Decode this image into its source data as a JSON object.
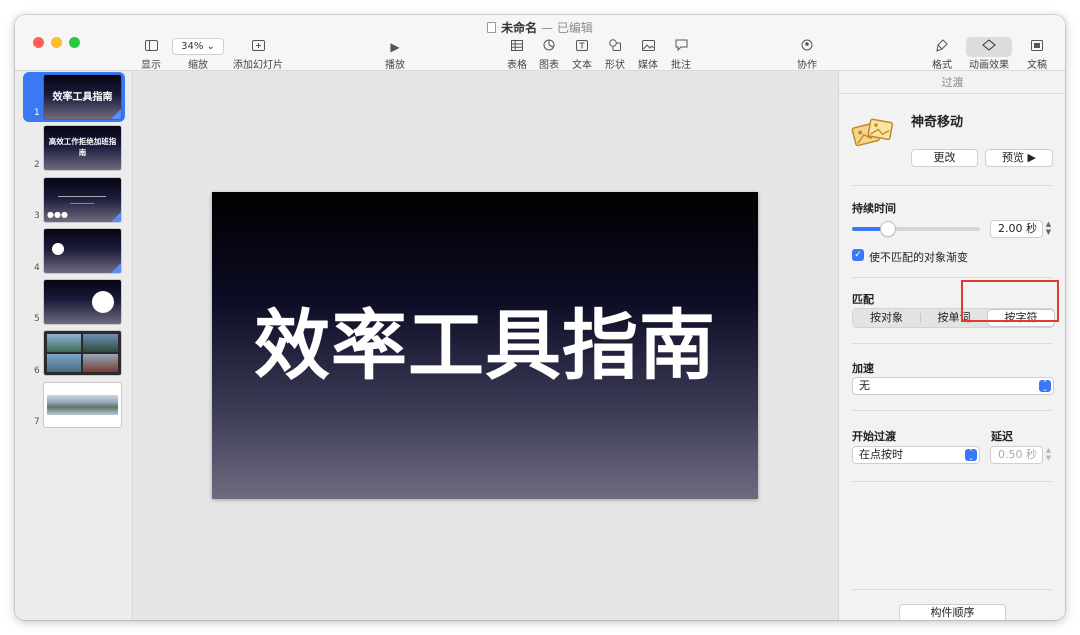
{
  "window": {
    "title": "未命名",
    "separator": "—",
    "status": "已编辑",
    "traffic_colors": [
      "#ff5f57",
      "#febc2e",
      "#28c840"
    ]
  },
  "toolbar": {
    "view_label": "显示",
    "zoom_value": "34%",
    "zoom_label": "缩放",
    "add_slide_label": "添加幻灯片",
    "play_label": "播放",
    "table_label": "表格",
    "chart_label": "图表",
    "text_label": "文本",
    "shape_label": "形状",
    "media_label": "媒体",
    "comment_label": "批注",
    "collaborate_label": "协作",
    "format_label": "格式",
    "animate_label": "动画效果",
    "document_label": "文稿"
  },
  "slides": [
    {
      "num": "1",
      "title": "效率工具指南"
    },
    {
      "num": "2",
      "title": "高效工作拒绝加班指南"
    },
    {
      "num": "3"
    },
    {
      "num": "4"
    },
    {
      "num": "5"
    },
    {
      "num": "6"
    },
    {
      "num": "7"
    }
  ],
  "canvas": {
    "slide_title": "效率工具指南"
  },
  "inspector": {
    "tab_label": "过渡",
    "effect_name": "神奇移动",
    "change_button": "更改",
    "preview_button": "预览 ▶",
    "duration_label": "持续时间",
    "duration_value": "2.00 秒",
    "duration_fraction": 0.28,
    "fade_checkbox_label": "使不匹配的对象渐变",
    "fade_checked": true,
    "match_label": "匹配",
    "match_options": [
      "按对象",
      "按单词",
      "按字符"
    ],
    "match_selected": "按字符",
    "accel_label": "加速",
    "accel_value": "无",
    "start_label": "开始过渡",
    "start_value": "在点按时",
    "delay_label": "延迟",
    "delay_value": "0.50 秒",
    "build_order_button": "构件顺序",
    "accent_color": "#3a78f6",
    "highlight_color": "#e23b2e"
  }
}
